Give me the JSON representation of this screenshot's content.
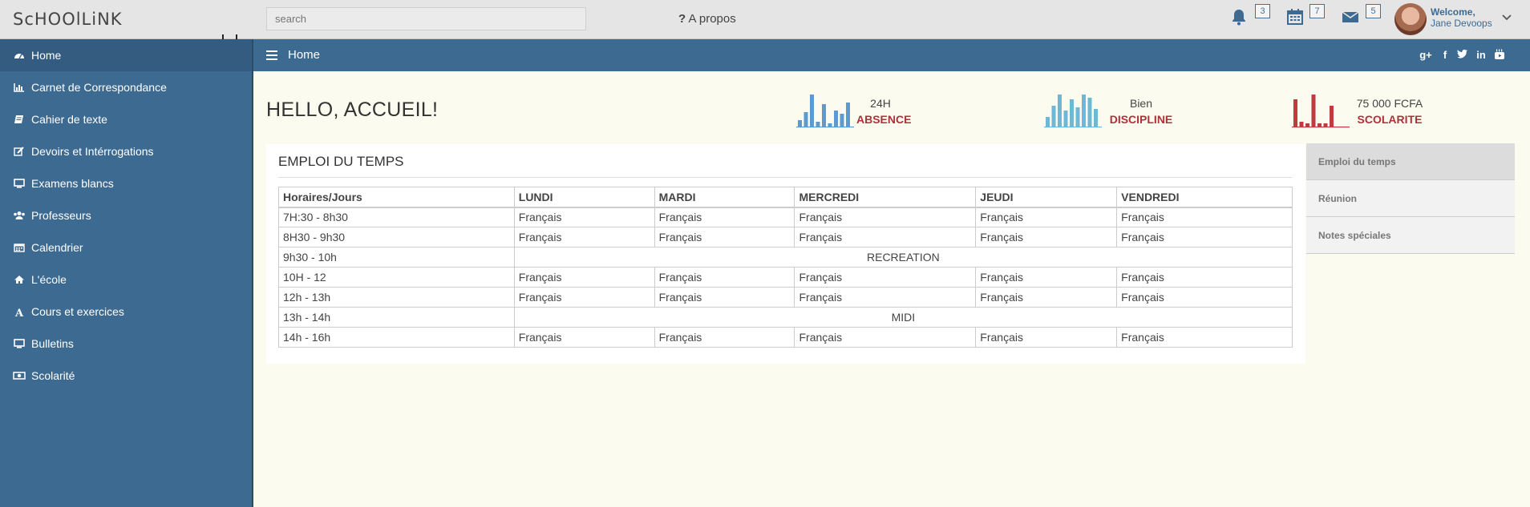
{
  "brand": "ScHOOlLiNK",
  "search": {
    "placeholder": "search",
    "value": ""
  },
  "apropos": {
    "mark": "?",
    "label": "A propos"
  },
  "notifications": [
    {
      "icon": "bell-icon",
      "count": "3"
    },
    {
      "icon": "calendar-icon",
      "count": "7"
    },
    {
      "icon": "envelope-icon",
      "count": "5"
    }
  ],
  "user": {
    "welcome": "Welcome,",
    "name": "Jane Devoops"
  },
  "sidebar": {
    "items": [
      {
        "label": "Home",
        "icon": "dashboard-icon"
      },
      {
        "label": "Carnet de Correspondance",
        "icon": "bar-chart-icon"
      },
      {
        "label": "Cahier de texte",
        "icon": "book-icon"
      },
      {
        "label": "Devoirs et Intérrogations",
        "icon": "edit-icon"
      },
      {
        "label": "Examens blancs",
        "icon": "desktop-icon"
      },
      {
        "label": "Professeurs",
        "icon": "users-icon"
      },
      {
        "label": "Calendrier",
        "icon": "calendar-icon"
      },
      {
        "label": "L'école",
        "icon": "home-icon"
      },
      {
        "label": "Cours et exercices",
        "icon": "font-icon"
      },
      {
        "label": "Bulletins",
        "icon": "desktop-icon"
      },
      {
        "label": "Scolarité",
        "icon": "money-icon"
      }
    ]
  },
  "pagebar": {
    "title": "Home",
    "social": [
      "google-plus-icon",
      "facebook-icon",
      "twitter-icon",
      "linkedin-icon",
      "youtube-icon"
    ]
  },
  "hello": "HELLO, ACCUEIL!",
  "stats": [
    {
      "value": "24H",
      "label": "ABSENCE",
      "color": "#5b9bd1",
      "bars": [
        0.2,
        0.45,
        1.0,
        0.15,
        0.7,
        0.1,
        0.5,
        0.4,
        0.75
      ]
    },
    {
      "value": "Bien",
      "label": "DISCIPLINE",
      "color": "#6cb8d6",
      "bars": [
        0.3,
        0.65,
        1.0,
        0.5,
        0.85,
        0.6,
        1.0,
        0.9,
        0.55
      ]
    },
    {
      "value": "75 000 FCFA",
      "label": "SCOLARITE",
      "color": "#bf3b3e",
      "bars": [
        0.85,
        0.15,
        0.1,
        1.0,
        0.1,
        0.1,
        0.65
      ]
    }
  ],
  "timetable": {
    "title": "EMPLOI DU TEMPS",
    "headers": [
      "Horaires/Jours",
      "LUNDI",
      "MARDI",
      "MERCREDI",
      "JEUDI",
      "VENDREDI"
    ],
    "rows": [
      {
        "time": "7H:30 - 8h30",
        "cells": [
          "Français",
          "Français",
          "Français",
          "Français",
          "Français"
        ]
      },
      {
        "time": "8H30 - 9h30",
        "cells": [
          "Français",
          "Français",
          "Français",
          "Français",
          "Français"
        ]
      },
      {
        "time": "9h30 - 10h",
        "merged": "RECREATION"
      },
      {
        "time": "10H - 12",
        "cells": [
          "Français",
          "Français",
          "Français",
          "Français",
          "Français"
        ]
      },
      {
        "time": "12h - 13h",
        "cells": [
          "Français",
          "Français",
          "Français",
          "Français",
          "Français"
        ]
      },
      {
        "time": "13h - 14h",
        "merged": "MIDI"
      },
      {
        "time": "14h - 16h",
        "cells": [
          "Français",
          "Français",
          "Français",
          "Français",
          "Français"
        ]
      }
    ]
  },
  "right_tabs": [
    {
      "label": "Emploi du temps",
      "active": true
    },
    {
      "label": "Réunion",
      "active": false
    },
    {
      "label": "Notes spéciales",
      "active": false
    }
  ]
}
